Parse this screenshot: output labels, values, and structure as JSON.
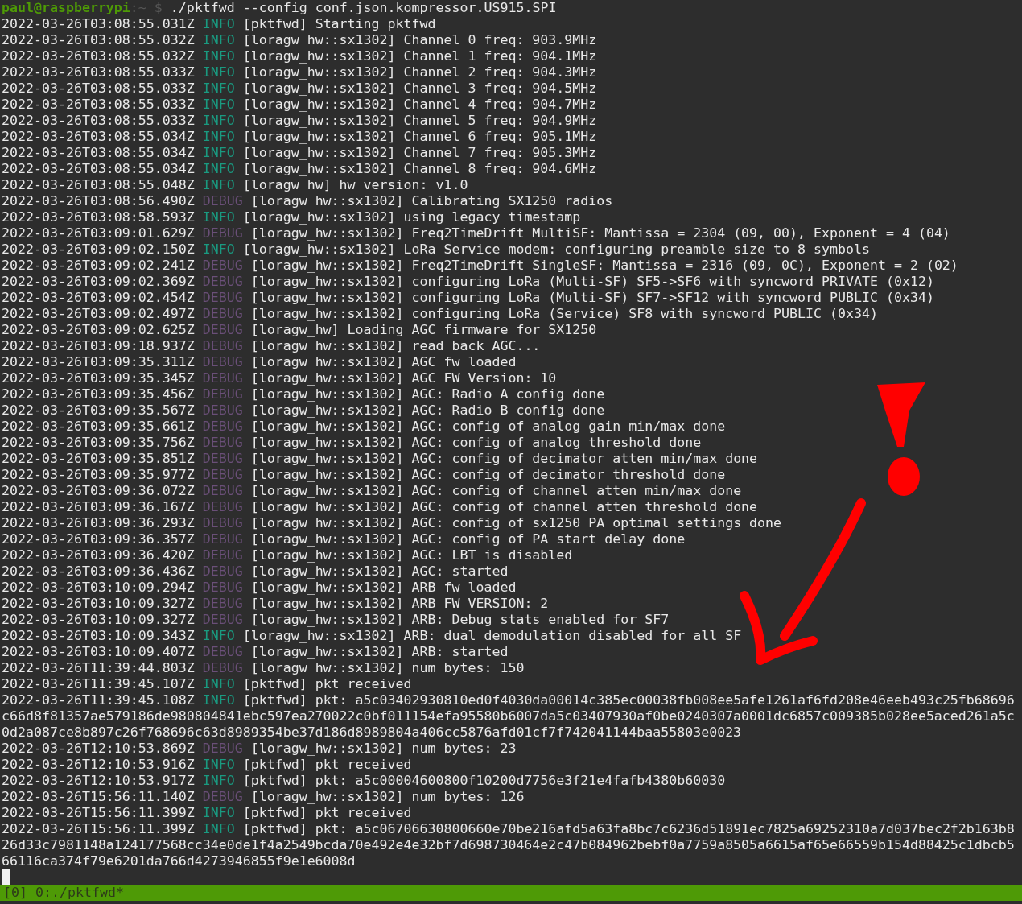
{
  "prompt": {
    "user_host": "paul@raspberrypi",
    "path": ":~",
    "symbol": "$",
    "command": "./pktfwd --config conf.json.kompressor.US915.SPI"
  },
  "log": [
    {
      "time": "2022-03-26T03:08:55.031Z",
      "level": "INFO",
      "source": "[pktfwd]",
      "message": "Starting pktfwd"
    },
    {
      "time": "2022-03-26T03:08:55.032Z",
      "level": "INFO",
      "source": "[loragw_hw::sx1302]",
      "message": "Channel 0 freq: 903.9MHz"
    },
    {
      "time": "2022-03-26T03:08:55.032Z",
      "level": "INFO",
      "source": "[loragw_hw::sx1302]",
      "message": "Channel 1 freq: 904.1MHz"
    },
    {
      "time": "2022-03-26T03:08:55.033Z",
      "level": "INFO",
      "source": "[loragw_hw::sx1302]",
      "message": "Channel 2 freq: 904.3MHz"
    },
    {
      "time": "2022-03-26T03:08:55.033Z",
      "level": "INFO",
      "source": "[loragw_hw::sx1302]",
      "message": "Channel 3 freq: 904.5MHz"
    },
    {
      "time": "2022-03-26T03:08:55.033Z",
      "level": "INFO",
      "source": "[loragw_hw::sx1302]",
      "message": "Channel 4 freq: 904.7MHz"
    },
    {
      "time": "2022-03-26T03:08:55.033Z",
      "level": "INFO",
      "source": "[loragw_hw::sx1302]",
      "message": "Channel 5 freq: 904.9MHz"
    },
    {
      "time": "2022-03-26T03:08:55.034Z",
      "level": "INFO",
      "source": "[loragw_hw::sx1302]",
      "message": "Channel 6 freq: 905.1MHz"
    },
    {
      "time": "2022-03-26T03:08:55.034Z",
      "level": "INFO",
      "source": "[loragw_hw::sx1302]",
      "message": "Channel 7 freq: 905.3MHz"
    },
    {
      "time": "2022-03-26T03:08:55.034Z",
      "level": "INFO",
      "source": "[loragw_hw::sx1302]",
      "message": "Channel 8 freq: 904.6MHz"
    },
    {
      "time": "2022-03-26T03:08:55.048Z",
      "level": "INFO",
      "source": "[loragw_hw]",
      "message": "hw_version: v1.0"
    },
    {
      "time": "2022-03-26T03:08:56.490Z",
      "level": "DEBUG",
      "source": "[loragw_hw::sx1302]",
      "message": "Calibrating SX1250 radios"
    },
    {
      "time": "2022-03-26T03:08:58.593Z",
      "level": "INFO",
      "source": "[loragw_hw::sx1302]",
      "message": "using legacy timestamp"
    },
    {
      "time": "2022-03-26T03:09:01.629Z",
      "level": "DEBUG",
      "source": "[loragw_hw::sx1302]",
      "message": "Freq2TimeDrift MultiSF: Mantissa = 2304 (09, 00), Exponent = 4 (04)"
    },
    {
      "time": "2022-03-26T03:09:02.150Z",
      "level": "INFO",
      "source": "[loragw_hw::sx1302]",
      "message": "LoRa Service modem: configuring preamble size to 8 symbols"
    },
    {
      "time": "2022-03-26T03:09:02.241Z",
      "level": "DEBUG",
      "source": "[loragw_hw::sx1302]",
      "message": "Freq2TimeDrift SingleSF: Mantissa = 2316 (09, 0C), Exponent = 2 (02)"
    },
    {
      "time": "2022-03-26T03:09:02.369Z",
      "level": "DEBUG",
      "source": "[loragw_hw::sx1302]",
      "message": "configuring LoRa (Multi-SF) SF5->SF6 with syncword PRIVATE (0x12)"
    },
    {
      "time": "2022-03-26T03:09:02.454Z",
      "level": "DEBUG",
      "source": "[loragw_hw::sx1302]",
      "message": "configuring LoRa (Multi-SF) SF7->SF12 with syncword PUBLIC (0x34)"
    },
    {
      "time": "2022-03-26T03:09:02.497Z",
      "level": "DEBUG",
      "source": "[loragw_hw::sx1302]",
      "message": "configuring LoRa (Service) SF8 with syncword PUBLIC (0x34)"
    },
    {
      "time": "2022-03-26T03:09:02.625Z",
      "level": "DEBUG",
      "source": "[loragw_hw]",
      "message": "Loading AGC firmware for SX1250"
    },
    {
      "time": "2022-03-26T03:09:18.937Z",
      "level": "DEBUG",
      "source": "[loragw_hw::sx1302]",
      "message": "read back AGC..."
    },
    {
      "time": "2022-03-26T03:09:35.311Z",
      "level": "DEBUG",
      "source": "[loragw_hw::sx1302]",
      "message": "AGC fw loaded"
    },
    {
      "time": "2022-03-26T03:09:35.345Z",
      "level": "DEBUG",
      "source": "[loragw_hw::sx1302]",
      "message": "AGC FW Version: 10"
    },
    {
      "time": "2022-03-26T03:09:35.456Z",
      "level": "DEBUG",
      "source": "[loragw_hw::sx1302]",
      "message": "AGC: Radio A config done"
    },
    {
      "time": "2022-03-26T03:09:35.567Z",
      "level": "DEBUG",
      "source": "[loragw_hw::sx1302]",
      "message": "AGC: Radio B config done"
    },
    {
      "time": "2022-03-26T03:09:35.661Z",
      "level": "DEBUG",
      "source": "[loragw_hw::sx1302]",
      "message": "AGC: config of analog gain min/max done"
    },
    {
      "time": "2022-03-26T03:09:35.756Z",
      "level": "DEBUG",
      "source": "[loragw_hw::sx1302]",
      "message": "AGC: config of analog threshold done"
    },
    {
      "time": "2022-03-26T03:09:35.851Z",
      "level": "DEBUG",
      "source": "[loragw_hw::sx1302]",
      "message": "AGC: config of decimator atten min/max done"
    },
    {
      "time": "2022-03-26T03:09:35.977Z",
      "level": "DEBUG",
      "source": "[loragw_hw::sx1302]",
      "message": "AGC: config of decimator threshold done"
    },
    {
      "time": "2022-03-26T03:09:36.072Z",
      "level": "DEBUG",
      "source": "[loragw_hw::sx1302]",
      "message": "AGC: config of channel atten min/max done"
    },
    {
      "time": "2022-03-26T03:09:36.167Z",
      "level": "DEBUG",
      "source": "[loragw_hw::sx1302]",
      "message": "AGC: config of channel atten threshold done"
    },
    {
      "time": "2022-03-26T03:09:36.293Z",
      "level": "DEBUG",
      "source": "[loragw_hw::sx1302]",
      "message": "AGC: config of sx1250 PA optimal settings done"
    },
    {
      "time": "2022-03-26T03:09:36.357Z",
      "level": "DEBUG",
      "source": "[loragw_hw::sx1302]",
      "message": "AGC: config of PA start delay done"
    },
    {
      "time": "2022-03-26T03:09:36.420Z",
      "level": "DEBUG",
      "source": "[loragw_hw::sx1302]",
      "message": "AGC: LBT is disabled"
    },
    {
      "time": "2022-03-26T03:09:36.436Z",
      "level": "DEBUG",
      "source": "[loragw_hw::sx1302]",
      "message": "AGC: started"
    },
    {
      "time": "2022-03-26T03:10:09.294Z",
      "level": "DEBUG",
      "source": "[loragw_hw::sx1302]",
      "message": "ARB fw loaded"
    },
    {
      "time": "2022-03-26T03:10:09.327Z",
      "level": "DEBUG",
      "source": "[loragw_hw::sx1302]",
      "message": "ARB FW VERSION: 2"
    },
    {
      "time": "2022-03-26T03:10:09.327Z",
      "level": "DEBUG",
      "source": "[loragw_hw::sx1302]",
      "message": "ARB: Debug stats enabled for SF7"
    },
    {
      "time": "2022-03-26T03:10:09.343Z",
      "level": "INFO",
      "source": "[loragw_hw::sx1302]",
      "message": "ARB: dual demodulation disabled for all SF"
    },
    {
      "time": "2022-03-26T03:10:09.407Z",
      "level": "DEBUG",
      "source": "[loragw_hw::sx1302]",
      "message": "ARB: started"
    },
    {
      "time": "2022-03-26T11:39:44.803Z",
      "level": "DEBUG",
      "source": "[loragw_hw::sx1302]",
      "message": "num bytes: 150"
    },
    {
      "time": "2022-03-26T11:39:45.107Z",
      "level": "INFO",
      "source": "[pktfwd]",
      "message": "pkt received"
    },
    {
      "time": "2022-03-26T11:39:45.108Z",
      "level": "INFO",
      "source": "[pktfwd]",
      "message": "pkt: a5c03402930810ed0f4030da00014c385ec00038fb008ee5afe1261af6fd208e46eeb493c25fb68696c66d8f81357ae579186de980804841ebc597ea270022c0bf011154efa95580b6007da5c03407930af0be0240307a0001dc6857c009385b028ee5aced261a5c0d2a087ce8b897c26f768696c63d8989354be37d186d8989804a406cc5876afd01cf7f742041144baa55803e0023"
    },
    {
      "time": "2022-03-26T12:10:53.869Z",
      "level": "DEBUG",
      "source": "[loragw_hw::sx1302]",
      "message": "num bytes: 23"
    },
    {
      "time": "2022-03-26T12:10:53.916Z",
      "level": "INFO",
      "source": "[pktfwd]",
      "message": "pkt received"
    },
    {
      "time": "2022-03-26T12:10:53.917Z",
      "level": "INFO",
      "source": "[pktfwd]",
      "message": "pkt: a5c00004600800f10200d7756e3f21e4fafb4380b60030"
    },
    {
      "time": "2022-03-26T15:56:11.140Z",
      "level": "DEBUG",
      "source": "[loragw_hw::sx1302]",
      "message": "num bytes: 126"
    },
    {
      "time": "2022-03-26T15:56:11.399Z",
      "level": "INFO",
      "source": "[pktfwd]",
      "message": "pkt received"
    },
    {
      "time": "2022-03-26T15:56:11.399Z",
      "level": "INFO",
      "source": "[pktfwd]",
      "message": "pkt: a5c06706630800660e70be216afd5a63fa8bc7c6236d51891ec7825a69252310a7d037bec2f2b163b826d33c7981148a124177568cc34e0de1f4a2549bcda70e492e4e32bf7d698730464e2c47b084962bebf0a7759a8505a6615af65e66559b154d88425c1dbcb566116ca374f79e6201da766d4273946855f9e1e6008d"
    }
  ],
  "status_bar": {
    "session": "[0]",
    "window": "0:./pktfwd*"
  }
}
